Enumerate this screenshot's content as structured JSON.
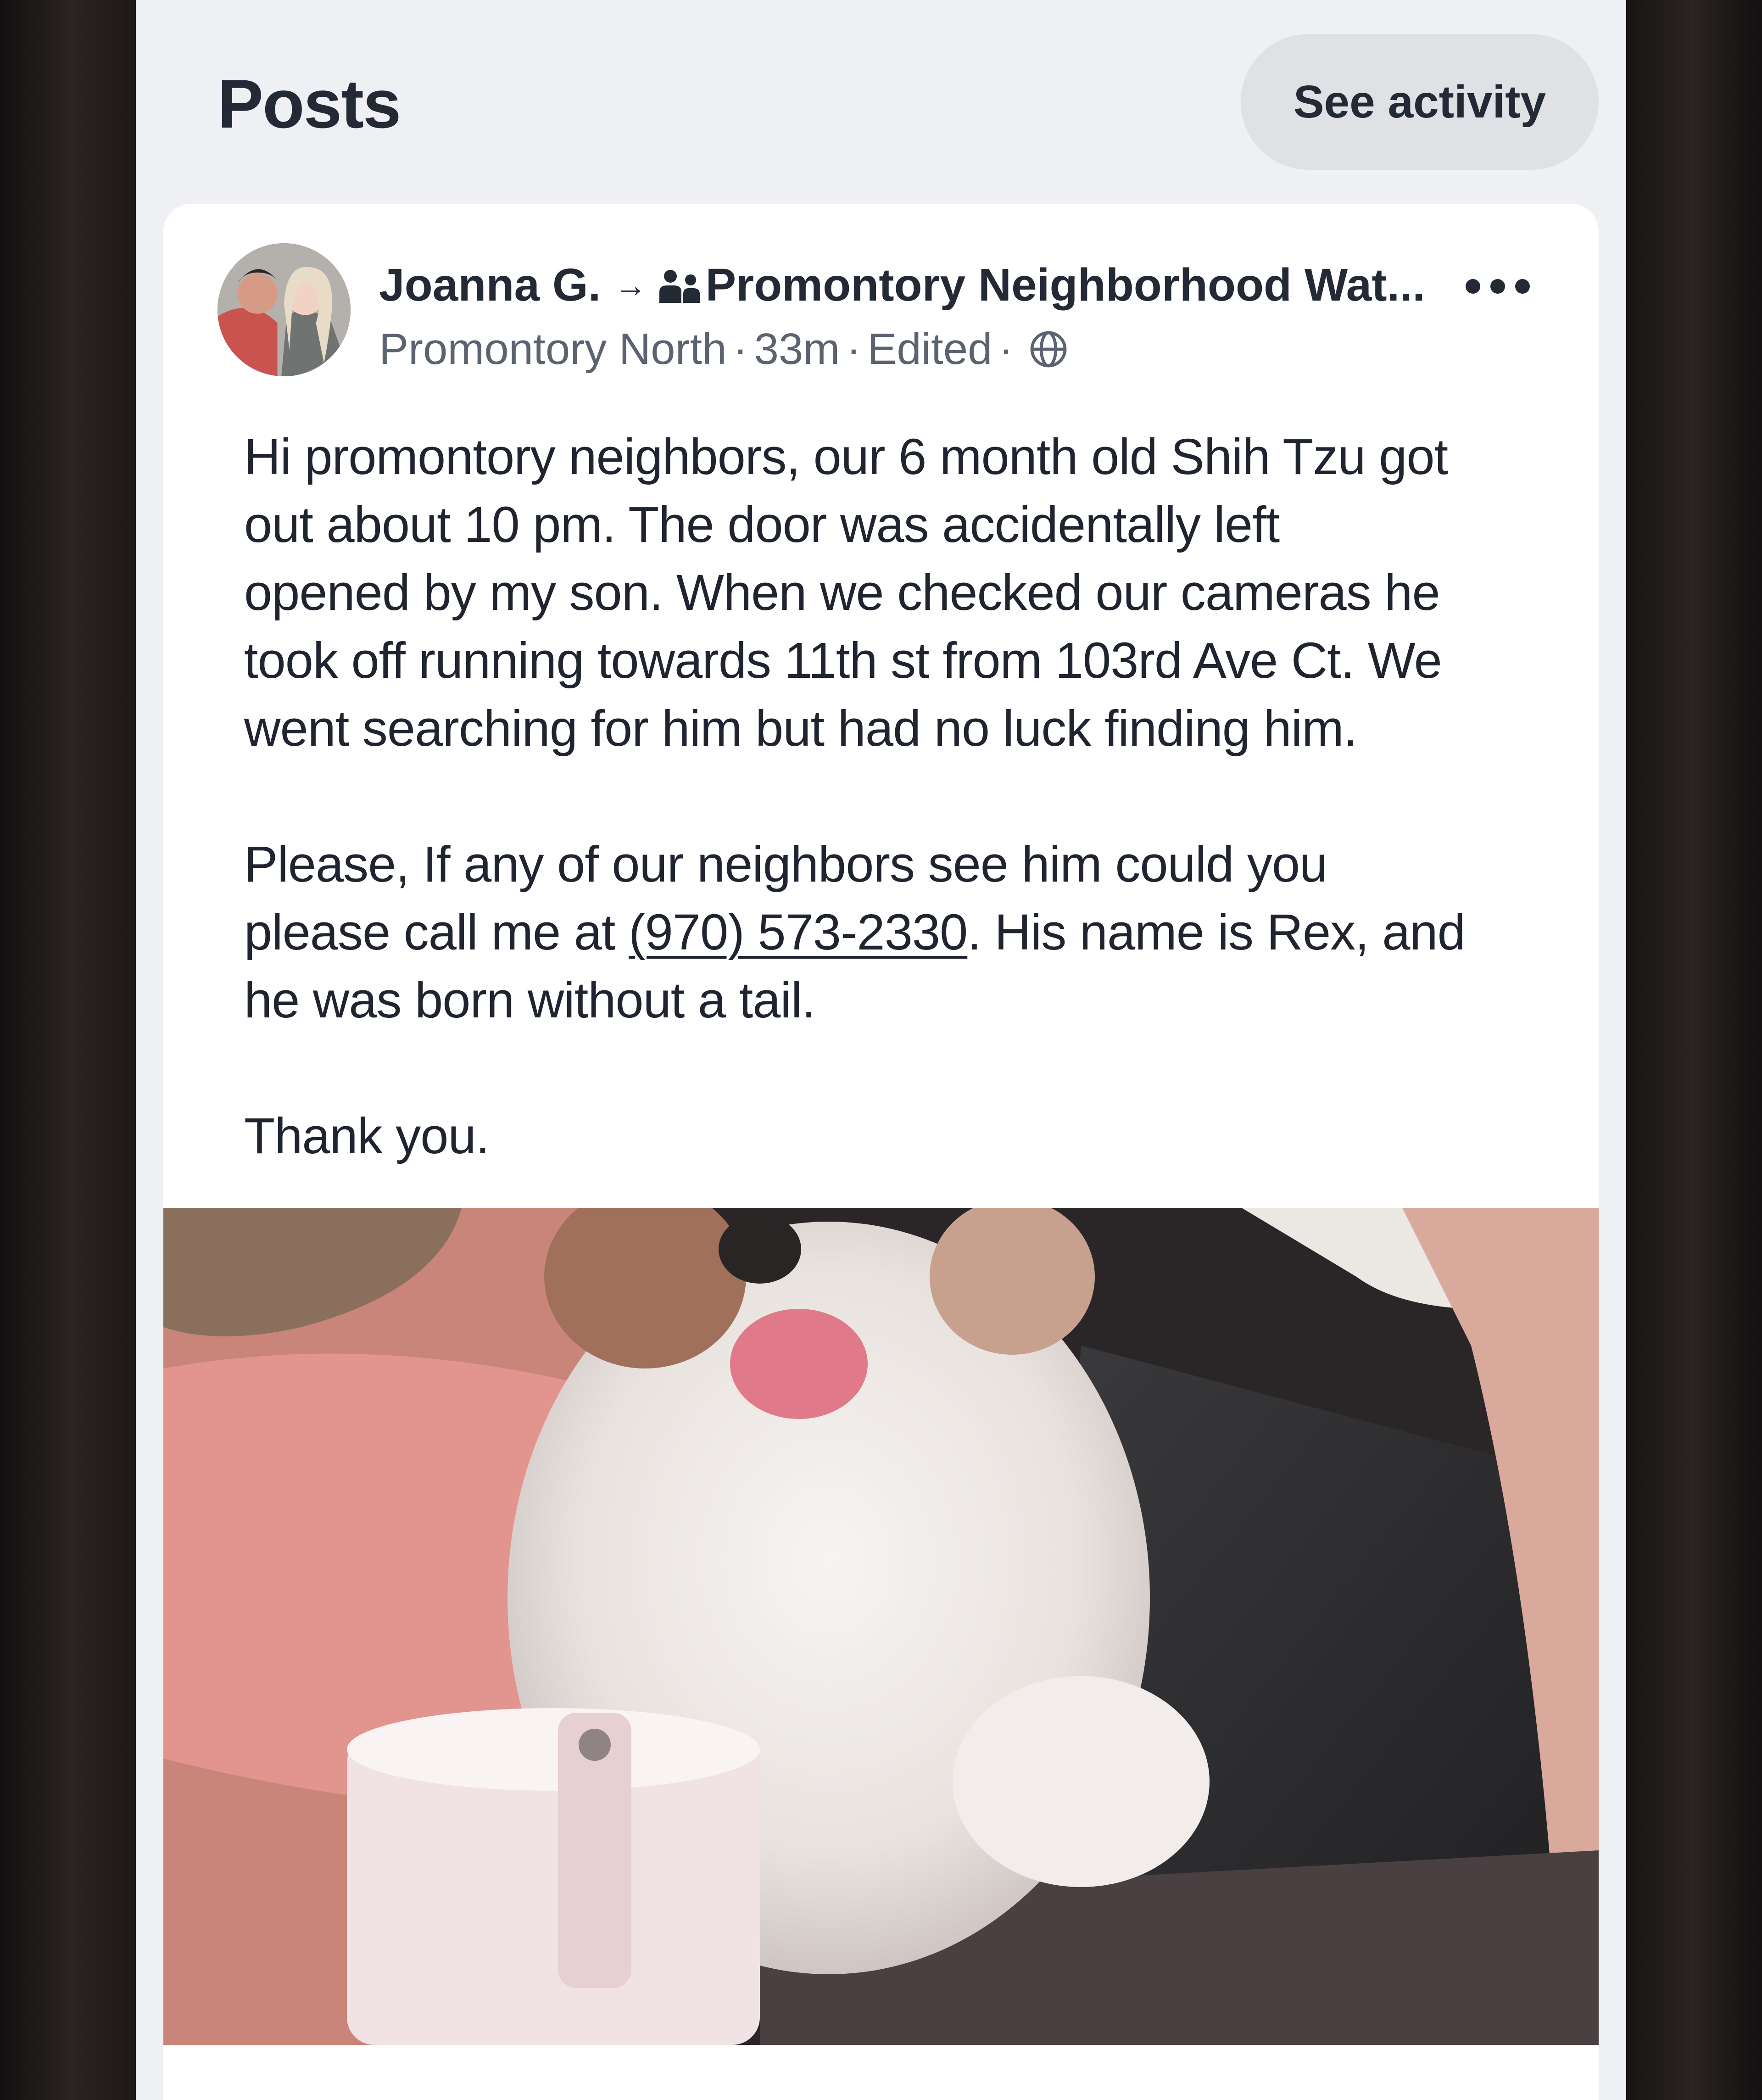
{
  "header": {
    "title": "Posts",
    "see_activity_label": "See activity"
  },
  "post": {
    "author": "Joanna G.",
    "arrow": "→",
    "group_icon": "group-icon",
    "group_name": "Promontory Neighborhood Wat...",
    "neighborhood": "Promontory North",
    "time": "33m",
    "edited": "Edited",
    "separator": "·",
    "visibility_icon": "globe-icon",
    "more_icon": "more-horizontal-icon",
    "body": {
      "p1": "Hi promontory neighbors, our 6 month old Shih Tzu got out about 10 pm.  The door was accidentally left opened by my son. When we checked our cameras he took off running towards 11th st from 103rd Ave Ct. We went searching for him but had no luck finding him.",
      "p1_lines": [
        "Hi promontory neighbors, our 6 month old Shih Tzu got",
        "out about 10 pm.  The door was accidentally left",
        "opened by my son. When we checked our cameras he",
        "took off running towards 11th st from 103rd Ave Ct. We",
        "went searching for him but had no luck finding him."
      ],
      "p2_line1": "Please, If any of our neighbors see him could you",
      "p2_line2_before": "please call me at ",
      "phone": "(970) 573-2330",
      "p2_line2_after": ". His name is Rex, and",
      "p2_line3": "he was born without a tail.",
      "p3": "Thank you."
    },
    "photo_subject": "white Shih Tzu puppy in a car"
  }
}
